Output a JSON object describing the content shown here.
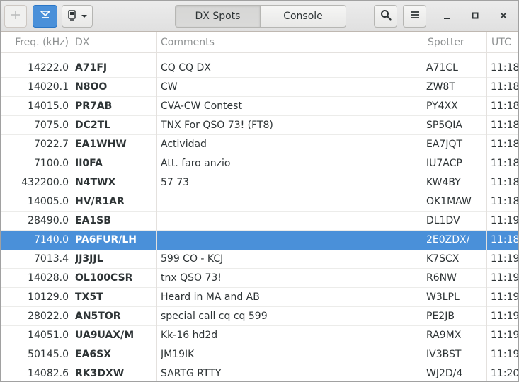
{
  "headerbar": {
    "add_icon": "plus-icon",
    "filter_icon": "filter-icon",
    "device_icon": "device-icon",
    "dropdown_icon": "chevron-down-icon",
    "tabs": [
      {
        "label": "DX Spots",
        "active": true
      },
      {
        "label": "Console",
        "active": false
      }
    ],
    "search_icon": "search-icon",
    "menu_icon": "hamburger-menu-icon",
    "minimize_icon": "minimize-icon",
    "maximize_icon": "maximize-icon",
    "close_icon": "close-icon"
  },
  "table": {
    "columns": [
      "Freq. (kHz)",
      "DX",
      "Comments",
      "Spotter",
      "UTC"
    ],
    "rows": [
      {
        "freq": "14222.0",
        "dx": "A71FJ",
        "comments": "CQ CQ DX",
        "spotter": "A71CL",
        "utc": "11:18",
        "selected": false
      },
      {
        "freq": "14020.1",
        "dx": "N8OO",
        "comments": "CW",
        "spotter": "ZW8T",
        "utc": "11:18",
        "selected": false
      },
      {
        "freq": "14015.0",
        "dx": "PR7AB",
        "comments": "CVA-CW Contest",
        "spotter": "PY4XX",
        "utc": "11:18",
        "selected": false
      },
      {
        "freq": "7075.0",
        "dx": "DC2TL",
        "comments": "TNX For QSO 73! (FT8)",
        "spotter": "SP5QIA",
        "utc": "11:18",
        "selected": false
      },
      {
        "freq": "7022.7",
        "dx": "EA1WHW",
        "comments": "Actividad",
        "spotter": "EA7JQT",
        "utc": "11:18",
        "selected": false
      },
      {
        "freq": "7100.0",
        "dx": "II0FA",
        "comments": "Att. faro anzio",
        "spotter": "IU7ACP",
        "utc": "11:18",
        "selected": false
      },
      {
        "freq": "432200.0",
        "dx": "N4TWX",
        "comments": "57 73",
        "spotter": "KW4BY",
        "utc": "11:18",
        "selected": false
      },
      {
        "freq": "14005.0",
        "dx": "HV/R1AR",
        "comments": "",
        "spotter": "OK1MAW",
        "utc": "11:18",
        "selected": false
      },
      {
        "freq": "28490.0",
        "dx": "EA1SB",
        "comments": "",
        "spotter": "DL1DV",
        "utc": "11:19",
        "selected": false
      },
      {
        "freq": "7140.0",
        "dx": "PA6FUR/LH",
        "comments": "",
        "spotter": "2E0ZDX/",
        "utc": "11:18",
        "selected": true
      },
      {
        "freq": "7013.4",
        "dx": "JJ3JJL",
        "comments": "599 CO - KCJ",
        "spotter": "K7SCX",
        "utc": "11:19",
        "selected": false
      },
      {
        "freq": "14028.0",
        "dx": "OL100CSR",
        "comments": "tnx QSO 73!",
        "spotter": "R6NW",
        "utc": "11:19",
        "selected": false
      },
      {
        "freq": "10129.0",
        "dx": "TX5T",
        "comments": "Heard in MA and AB",
        "spotter": "W3LPL",
        "utc": "11:19",
        "selected": false
      },
      {
        "freq": "28022.0",
        "dx": "AN5TOR",
        "comments": "special call cq cq 599",
        "spotter": "PE2JB",
        "utc": "11:19",
        "selected": false
      },
      {
        "freq": "14051.0",
        "dx": "UA9UAX/M",
        "comments": "Kk-16 hd2d",
        "spotter": "RA9MX",
        "utc": "11:19",
        "selected": false
      },
      {
        "freq": "50145.0",
        "dx": "EA6SX",
        "comments": "JM19IK",
        "spotter": "IV3BST",
        "utc": "11:19",
        "selected": false
      },
      {
        "freq": "14082.6",
        "dx": "RK3DXW",
        "comments": "SARTG RTTY",
        "spotter": "WJ2D/4",
        "utc": "11:20",
        "selected": false
      }
    ]
  },
  "colors": {
    "selection": "#4a90d9",
    "header_text": "#8d9091"
  }
}
